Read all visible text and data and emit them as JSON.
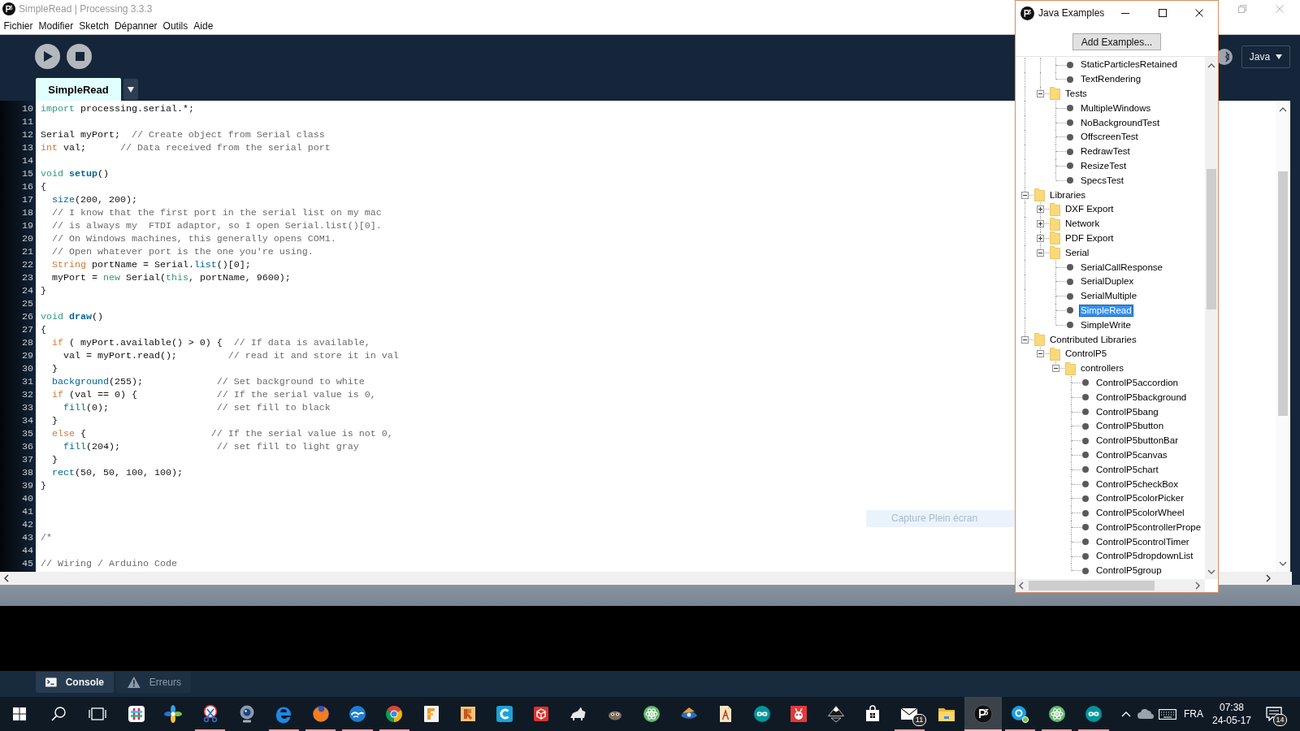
{
  "window": {
    "title": "SimpleRead | Processing 3.3.3"
  },
  "menu": [
    "Fichier",
    "Modifier",
    "Sketch",
    "Dépanner",
    "Outils",
    "Aide"
  ],
  "sketch_tabs": [
    {
      "label": "SimpleRead",
      "selected": true
    }
  ],
  "mode": {
    "label": "Java"
  },
  "editor": {
    "lines": [
      {
        "number": "10",
        "tokens": [
          {
            "kind": "keyword",
            "text": "import"
          },
          {
            "kind": "plain",
            "text": " processing.serial.*;"
          }
        ]
      },
      {
        "number": "11"
      },
      {
        "number": "12",
        "tokens": [
          {
            "kind": "plain",
            "text": "Serial myPort;  "
          },
          {
            "kind": "comment",
            "text": "// Create object from Serial class"
          }
        ]
      },
      {
        "number": "13",
        "tokens": [
          {
            "kind": "keyword2",
            "text": "int"
          },
          {
            "kind": "plain",
            "text": " val;      "
          },
          {
            "kind": "comment",
            "text": "// Data received from the serial port"
          }
        ]
      },
      {
        "number": "14"
      },
      {
        "number": "15",
        "tokens": [
          {
            "kind": "keyword",
            "text": "void"
          },
          {
            "kind": "function_def",
            "text": " setup"
          },
          {
            "kind": "plain",
            "text": "()"
          }
        ]
      },
      {
        "number": "16",
        "tokens": [
          {
            "kind": "plain",
            "text": "{"
          }
        ]
      },
      {
        "number": "17",
        "tokens": [
          {
            "kind": "function",
            "text": "  size"
          },
          {
            "kind": "plain",
            "text": "(200, 200);"
          }
        ]
      },
      {
        "number": "18",
        "tokens": [
          {
            "kind": "comment",
            "text": "  // I know that the first port in the serial list on my mac"
          }
        ]
      },
      {
        "number": "19",
        "tokens": [
          {
            "kind": "comment",
            "text": "  // is always my  FTDI adaptor, so I open Serial.list()[0]."
          }
        ]
      },
      {
        "number": "20",
        "tokens": [
          {
            "kind": "comment",
            "text": "  // On Windows machines, this generally opens COM1."
          }
        ]
      },
      {
        "number": "21",
        "tokens": [
          {
            "kind": "comment",
            "text": "  // Open whatever port is the one you're using."
          }
        ]
      },
      {
        "number": "22",
        "tokens": [
          {
            "kind": "keyword2",
            "text": "  String"
          },
          {
            "kind": "plain",
            "text": " portName = Serial."
          },
          {
            "kind": "function",
            "text": "list"
          },
          {
            "kind": "plain",
            "text": "()[0];"
          }
        ]
      },
      {
        "number": "23",
        "tokens": [
          {
            "kind": "plain",
            "text": "  myPort = "
          },
          {
            "kind": "keyword",
            "text": "new"
          },
          {
            "kind": "plain",
            "text": " Serial("
          },
          {
            "kind": "keyword",
            "text": "this"
          },
          {
            "kind": "plain",
            "text": ", portName, 9600);"
          }
        ]
      },
      {
        "number": "24",
        "tokens": [
          {
            "kind": "plain",
            "text": "}"
          }
        ]
      },
      {
        "number": "25"
      },
      {
        "number": "26",
        "tokens": [
          {
            "kind": "keyword",
            "text": "void"
          },
          {
            "kind": "function_def",
            "text": " draw"
          },
          {
            "kind": "plain",
            "text": "()"
          }
        ]
      },
      {
        "number": "27",
        "tokens": [
          {
            "kind": "plain",
            "text": "{"
          }
        ]
      },
      {
        "number": "28",
        "tokens": [
          {
            "kind": "keyword2",
            "text": "  if"
          },
          {
            "kind": "plain",
            "text": " ( myPort.available() > 0) {  "
          },
          {
            "kind": "comment",
            "text": "// If data is available,"
          }
        ]
      },
      {
        "number": "29",
        "tokens": [
          {
            "kind": "plain",
            "text": "    val = myPort.read();         "
          },
          {
            "kind": "comment",
            "text": "// read it and store it in val"
          }
        ]
      },
      {
        "number": "30",
        "tokens": [
          {
            "kind": "plain",
            "text": "  }"
          }
        ]
      },
      {
        "number": "31",
        "tokens": [
          {
            "kind": "function",
            "text": "  background"
          },
          {
            "kind": "plain",
            "text": "(255);             "
          },
          {
            "kind": "comment",
            "text": "// Set background to white"
          }
        ]
      },
      {
        "number": "32",
        "tokens": [
          {
            "kind": "keyword2",
            "text": "  if"
          },
          {
            "kind": "plain",
            "text": " (val == 0) {              "
          },
          {
            "kind": "comment",
            "text": "// If the serial value is 0,"
          }
        ]
      },
      {
        "number": "33",
        "tokens": [
          {
            "kind": "function",
            "text": "    fill"
          },
          {
            "kind": "plain",
            "text": "(0);                   "
          },
          {
            "kind": "comment",
            "text": "// set fill to black"
          }
        ]
      },
      {
        "number": "34",
        "tokens": [
          {
            "kind": "plain",
            "text": "  }"
          }
        ]
      },
      {
        "number": "35",
        "tokens": [
          {
            "kind": "keyword2",
            "text": "  else"
          },
          {
            "kind": "plain",
            "text": " {                      "
          },
          {
            "kind": "comment",
            "text": "// If the serial value is not 0,"
          }
        ]
      },
      {
        "number": "36",
        "tokens": [
          {
            "kind": "function",
            "text": "    fill"
          },
          {
            "kind": "plain",
            "text": "(204);                 "
          },
          {
            "kind": "comment",
            "text": "// set fill to light gray"
          }
        ]
      },
      {
        "number": "37",
        "tokens": [
          {
            "kind": "plain",
            "text": "  }"
          }
        ]
      },
      {
        "number": "38",
        "tokens": [
          {
            "kind": "function",
            "text": "  rect"
          },
          {
            "kind": "plain",
            "text": "(50, 50, 100, 100);"
          }
        ]
      },
      {
        "number": "39",
        "tokens": [
          {
            "kind": "plain",
            "text": "}"
          }
        ]
      },
      {
        "number": "40"
      },
      {
        "number": "41"
      },
      {
        "number": "42"
      },
      {
        "number": "43",
        "tokens": [
          {
            "kind": "comment",
            "text": "/*"
          }
        ]
      },
      {
        "number": "44"
      },
      {
        "number": "45",
        "tokens": [
          {
            "kind": "comment",
            "text": "// Wiring / Arduino Code"
          }
        ]
      }
    ]
  },
  "capture_notice": "Capture Plein écran",
  "console_tabs": [
    {
      "label": "Console",
      "kind": "console",
      "selected": true
    },
    {
      "label": "Erreurs",
      "kind": "errors",
      "selected": false
    }
  ],
  "examples_window": {
    "title": "Java Examples",
    "add_button": "Add Examples...",
    "tree": [
      {
        "children": [
          {
            "children": [
              {
                "label": "StaticParticlesRetained",
                "kind": "sketch",
                "selected": false
              },
              {
                "label": "TextRendering",
                "kind": "sketch",
                "selected": false
              }
            ]
          },
          {
            "label": "Tests",
            "kind": "folder",
            "expanded": true,
            "selected": false,
            "children": [
              {
                "label": "MultipleWindows",
                "kind": "sketch",
                "selected": false
              },
              {
                "label": "NoBackgroundTest",
                "kind": "sketch",
                "selected": false
              },
              {
                "label": "OffscreenTest",
                "kind": "sketch",
                "selected": false
              },
              {
                "label": "RedrawTest",
                "kind": "sketch",
                "selected": false
              },
              {
                "label": "ResizeTest",
                "kind": "sketch",
                "selected": false
              },
              {
                "label": "SpecsTest",
                "kind": "sketch",
                "selected": false
              }
            ]
          }
        ]
      },
      {
        "label": "Libraries",
        "kind": "folder",
        "expanded": true,
        "selected": false,
        "children": [
          {
            "label": "DXF Export",
            "kind": "folder",
            "expanded": false,
            "selected": false
          },
          {
            "label": "Network",
            "kind": "folder",
            "expanded": false,
            "selected": false
          },
          {
            "label": "PDF Export",
            "kind": "folder",
            "expanded": false,
            "selected": false
          },
          {
            "label": "Serial",
            "kind": "folder",
            "expanded": true,
            "selected": false,
            "children": [
              {
                "label": "SerialCallResponse",
                "kind": "sketch",
                "selected": false
              },
              {
                "label": "SerialDuplex",
                "kind": "sketch",
                "selected": false
              },
              {
                "label": "SerialMultiple",
                "kind": "sketch",
                "selected": false
              },
              {
                "label": "SimpleRead",
                "kind": "sketch",
                "selected": true
              },
              {
                "label": "SimpleWrite",
                "kind": "sketch",
                "selected": false
              }
            ]
          }
        ]
      },
      {
        "label": "Contributed Libraries",
        "kind": "folder",
        "expanded": true,
        "selected": false,
        "children": [
          {
            "label": "ControlP5",
            "kind": "folder",
            "expanded": true,
            "selected": false,
            "children": [
              {
                "label": "controllers",
                "kind": "folder",
                "expanded": true,
                "selected": false,
                "children": [
                  {
                    "label": "ControlP5accordion",
                    "kind": "sketch",
                    "selected": false
                  },
                  {
                    "label": "ControlP5background",
                    "kind": "sketch",
                    "selected": false
                  },
                  {
                    "label": "ControlP5bang",
                    "kind": "sketch",
                    "selected": false
                  },
                  {
                    "label": "ControlP5button",
                    "kind": "sketch",
                    "selected": false
                  },
                  {
                    "label": "ControlP5buttonBar",
                    "kind": "sketch",
                    "selected": false
                  },
                  {
                    "label": "ControlP5canvas",
                    "kind": "sketch",
                    "selected": false
                  },
                  {
                    "label": "ControlP5chart",
                    "kind": "sketch",
                    "selected": false
                  },
                  {
                    "label": "ControlP5checkBox",
                    "kind": "sketch",
                    "selected": false
                  },
                  {
                    "label": "ControlP5colorPicker",
                    "kind": "sketch",
                    "selected": false
                  },
                  {
                    "label": "ControlP5colorWheel",
                    "kind": "sketch",
                    "selected": false
                  },
                  {
                    "label": "ControlP5controllerPrope",
                    "kind": "sketch",
                    "selected": false
                  },
                  {
                    "label": "ControlP5controlTimer",
                    "kind": "sketch",
                    "selected": false
                  },
                  {
                    "label": "ControlP5dropdownList",
                    "kind": "sketch",
                    "selected": false
                  },
                  {
                    "label": "ControlP5group",
                    "kind": "sketch",
                    "selected": false
                  }
                ]
              }
            ]
          }
        ]
      }
    ]
  },
  "taskbar": {
    "apps": [
      {
        "running": false,
        "selected": false
      },
      {
        "running": false,
        "selected": false
      },
      {
        "running": true,
        "selected": false
      },
      {
        "running": false,
        "selected": false
      },
      {
        "running": true,
        "selected": false
      },
      {
        "running": true,
        "selected": false
      },
      {
        "running": true,
        "selected": false
      },
      {
        "running": true,
        "selected": false
      },
      {
        "running": false,
        "selected": false
      },
      {
        "running": false,
        "selected": false
      },
      {
        "running": false,
        "selected": false
      },
      {
        "running": false,
        "selected": false
      },
      {
        "running": false,
        "selected": false
      },
      {
        "running": false,
        "selected": false
      },
      {
        "running": false,
        "selected": false
      },
      {
        "running": false,
        "selected": false
      },
      {
        "running": false,
        "selected": false
      },
      {
        "running": false,
        "selected": false
      },
      {
        "running": false,
        "selected": false
      },
      {
        "running": false,
        "selected": false
      },
      {
        "running": false,
        "selected": false
      },
      {
        "running": true,
        "selected": false,
        "badge": "11"
      },
      {
        "running": false,
        "selected": false
      },
      {
        "running": true,
        "selected": true
      },
      {
        "running": true,
        "selected": false
      },
      {
        "running": true,
        "selected": false
      },
      {
        "running": true,
        "selected": false
      }
    ],
    "language": "FRA",
    "time": "07:38",
    "date": "24-05-17",
    "notification_count": "14"
  }
}
